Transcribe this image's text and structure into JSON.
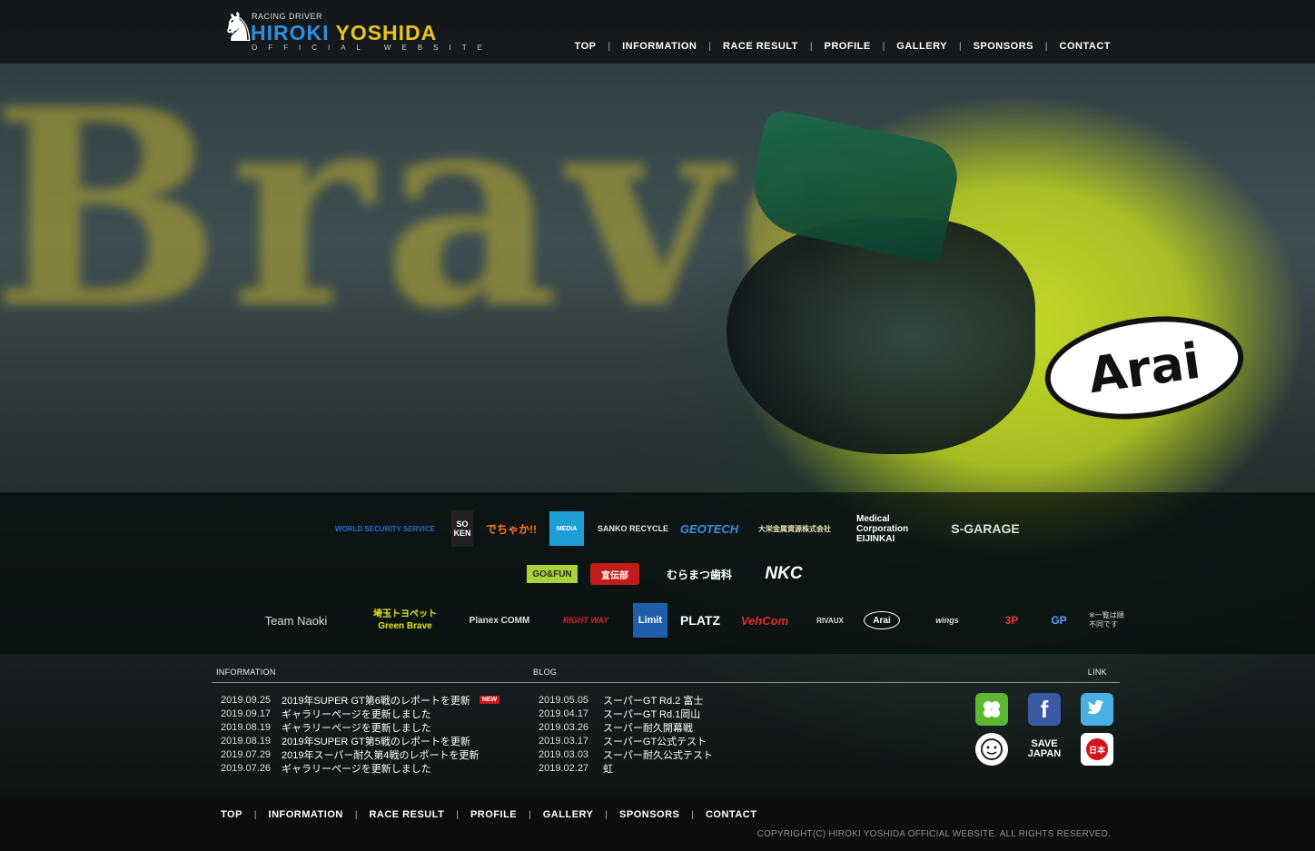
{
  "logo": {
    "tagline": "RACING DRIVER",
    "name_first": "HIROKI",
    "name_last": "YOSHIDA",
    "subtitle": "OFFICIAL WEBSITE"
  },
  "nav": [
    "TOP",
    "INFORMATION",
    "RACE RESULT",
    "PROFILE",
    "GALLERY",
    "SPONSORS",
    "CONTACT"
  ],
  "hero": {
    "background_text": "Brave",
    "helmet_brand": "Arai"
  },
  "sponsors": {
    "row1": [
      "WORLD SECURITY SERVICE",
      "SO KEN",
      "でちゃか!!",
      "MEDIA",
      "SANKO RECYCLE",
      "GEOTECH",
      "大栄金属資源株式会社",
      "Medical Corporation EIJINKAI",
      "S-GARAGE"
    ],
    "row2": [
      "GO&FUN",
      "宣伝部",
      "むらまつ歯科",
      "NKC"
    ],
    "row3": [
      "Team Naoki",
      "埼玉トヨペット Green Brave",
      "Planex COMM",
      "RIGHT WAY",
      "Limit",
      "PLATZ",
      "VehCom",
      "RIVAUX",
      "Arai",
      "wings",
      "3P",
      "GP"
    ],
    "note": "※一覧は順不同です"
  },
  "sections": {
    "information": "INFORMATION",
    "blog": "BLOG",
    "link": "LINK"
  },
  "information": [
    {
      "date": "2019.09.25",
      "title": "2019年SUPER GT第6戦のレポートを更新",
      "badge": "NEW"
    },
    {
      "date": "2019.09.17",
      "title": "ギャラリーページを更新しました"
    },
    {
      "date": "2019.08.19",
      "title": "ギャラリーページを更新しました"
    },
    {
      "date": "2019.08.19",
      "title": "2019年SUPER GT第5戦のレポートを更新"
    },
    {
      "date": "2019.07.29",
      "title": "2019年スーパー耐久第4戦のレポートを更新"
    },
    {
      "date": "2019.07.26",
      "title": "ギャラリーページを更新しました"
    }
  ],
  "blog": [
    {
      "date": "2019.05.05",
      "title": "スーパーGT Rd.2 富士"
    },
    {
      "date": "2019.04.17",
      "title": "スーパーGT Rd.1岡山"
    },
    {
      "date": "2019.03.26",
      "title": "スーパー耐久開幕戦"
    },
    {
      "date": "2019.03.17",
      "title": "スーパーGT公式テスト"
    },
    {
      "date": "2019.03.03",
      "title": "スーパー耐久公式テスト"
    },
    {
      "date": "2019.02.27",
      "title": "虹"
    }
  ],
  "links": {
    "facebook": "f",
    "save_japan": "SAVE JAPAN",
    "nihon": "日本"
  },
  "footer_nav": [
    "TOP",
    "INFORMATION",
    "RACE RESULT",
    "PROFILE",
    "GALLERY",
    "SPONSORS",
    "CONTACT"
  ],
  "copyright": "COPYRIGHT(C) HIROKI YOSHIDA OFFICIAL WEBSITE. ALL RIGHTS RESERVED."
}
